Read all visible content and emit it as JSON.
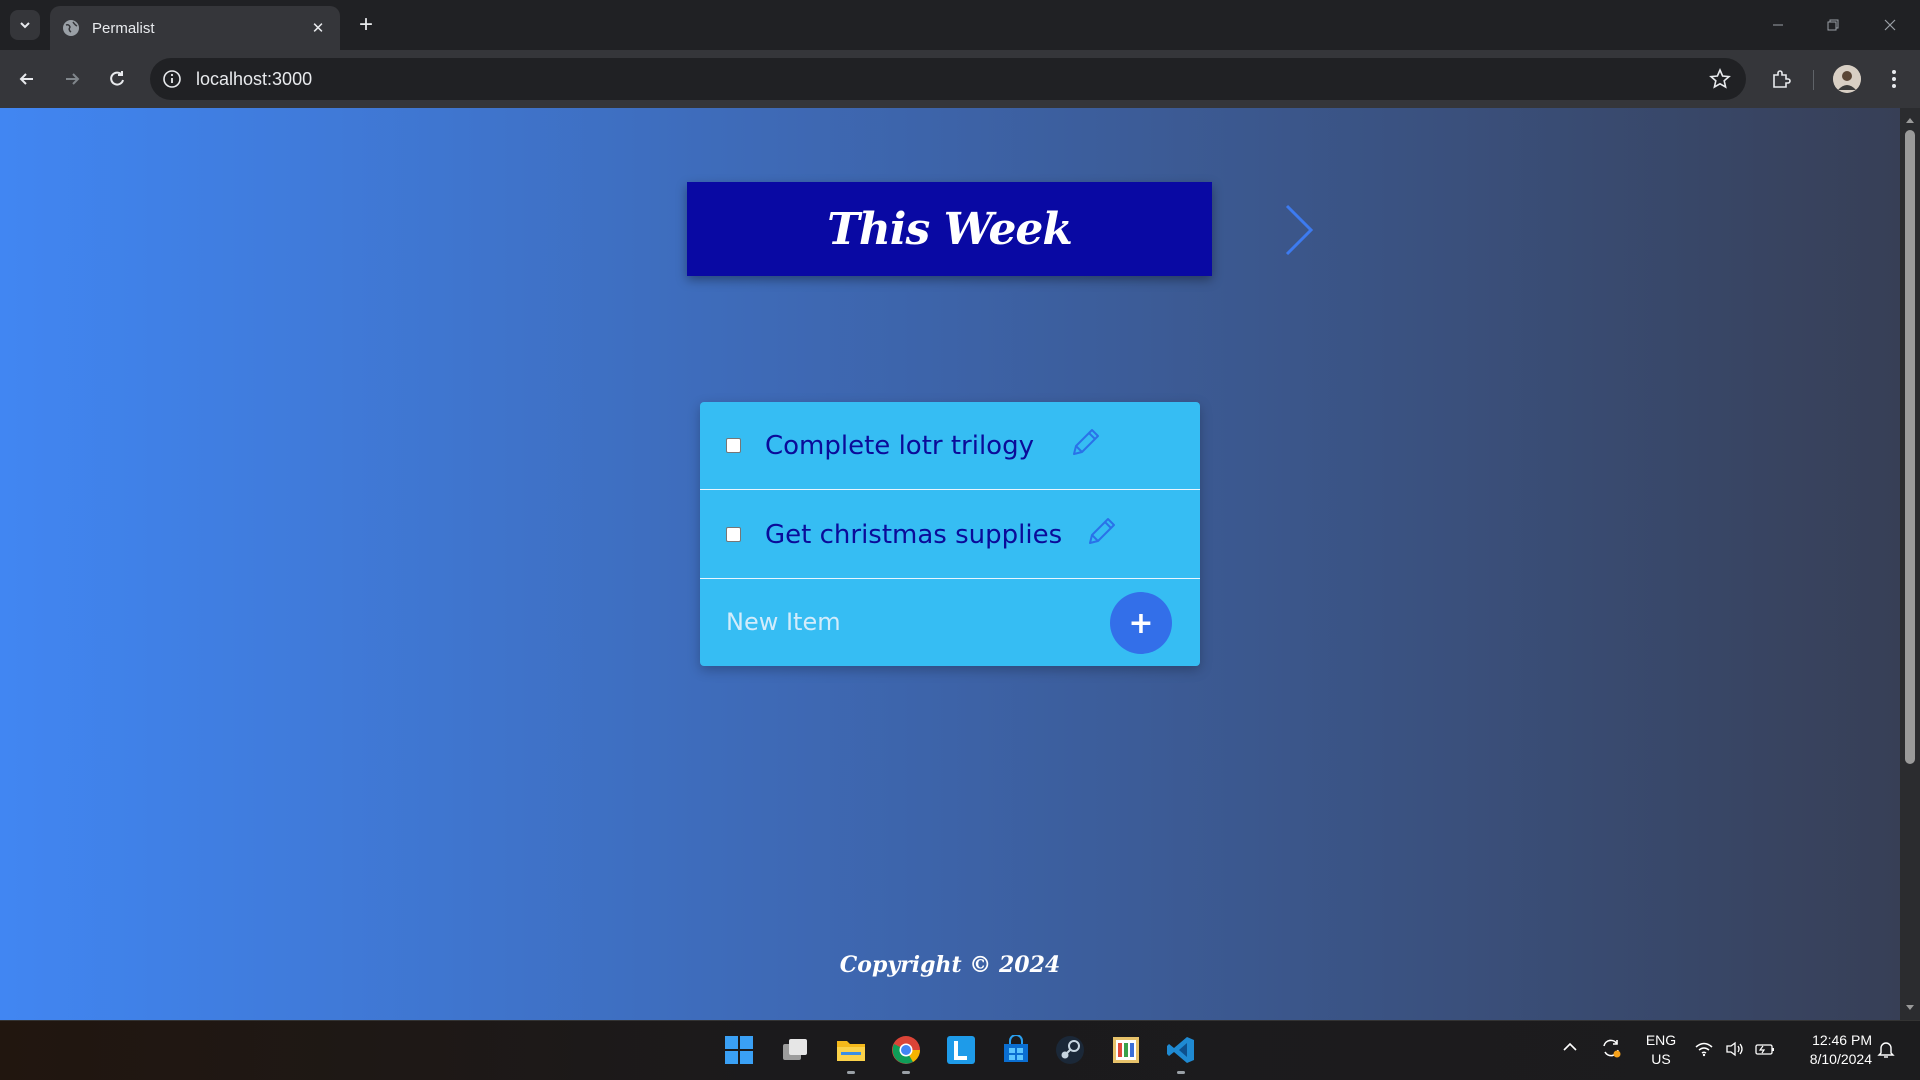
{
  "browser": {
    "tab_title": "Permalist",
    "tab_close": "✕",
    "new_tab": "+",
    "url": "localhost:3000"
  },
  "page": {
    "heading": "This Week",
    "items": [
      {
        "title": "Complete lotr trilogy",
        "checked": false
      },
      {
        "title": "Get christmas supplies",
        "checked": false
      }
    ],
    "new_item_placeholder": "New Item",
    "add_button_label": "+",
    "footer": "Copyright © 2024"
  },
  "taskbar": {
    "apps": [
      "windows-start",
      "task-view",
      "file-explorer",
      "chrome",
      "l-app",
      "store",
      "steam",
      "paint",
      "vscode"
    ],
    "language_top": "ENG",
    "language_bottom": "US",
    "time": "12:46 PM",
    "date": "8/10/2024"
  },
  "colors": {
    "heading_bg": "#0909a3",
    "card_bg": "#36bdf3",
    "item_text": "#0b0b99",
    "add_button": "#336fe9",
    "gradient_start": "#4186f2",
    "gradient_end": "#373f56"
  }
}
